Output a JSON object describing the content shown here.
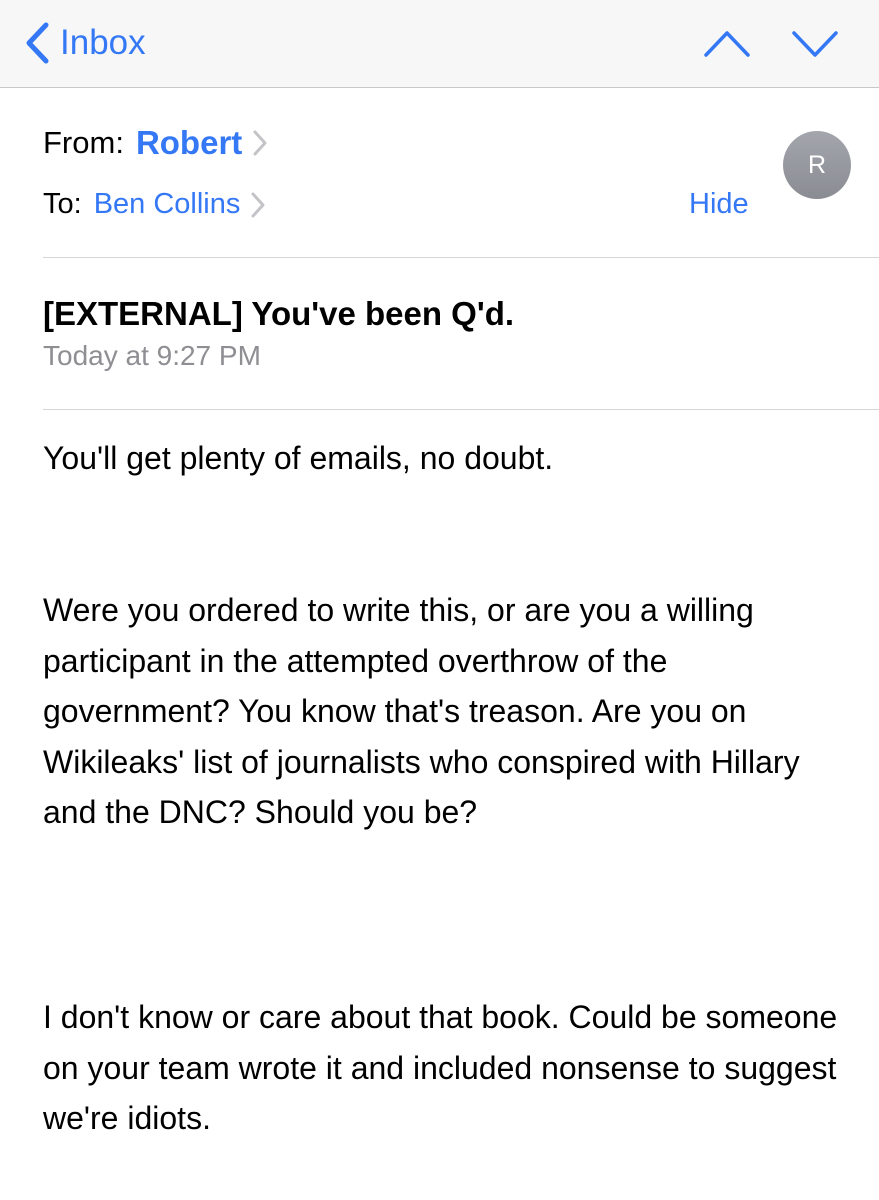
{
  "nav": {
    "back_label": "Inbox",
    "icons": {
      "back": "chevron-left-icon",
      "previous": "chevron-up-icon",
      "next": "chevron-down-icon"
    }
  },
  "header": {
    "from_label": "From:",
    "from_name": "Robert",
    "to_label": "To:",
    "to_name": "Ben Collins",
    "hide_label": "Hide",
    "avatar_initial": "R"
  },
  "message": {
    "subject": "[EXTERNAL] You've been Q'd.",
    "timestamp": "Today at 9:27 PM",
    "paragraphs": [
      "You'll get plenty of emails, no doubt.",
      "Were you ordered to write this, or are you a willing participant in the attempted overthrow of the government? You know that's treason. Are you on Wikileaks' list of journalists who conspired with Hillary and the DNC? Should you be?",
      "I don't know or care about that book. Could be someone on your team wrote it and included nonsense to suggest we're idiots."
    ]
  },
  "colors": {
    "accent": "#3478f6",
    "nav_background": "#f7f7f7",
    "secondary_text": "#8e8e93",
    "avatar": "#9a9ca3",
    "divider": "#d6d6da"
  }
}
